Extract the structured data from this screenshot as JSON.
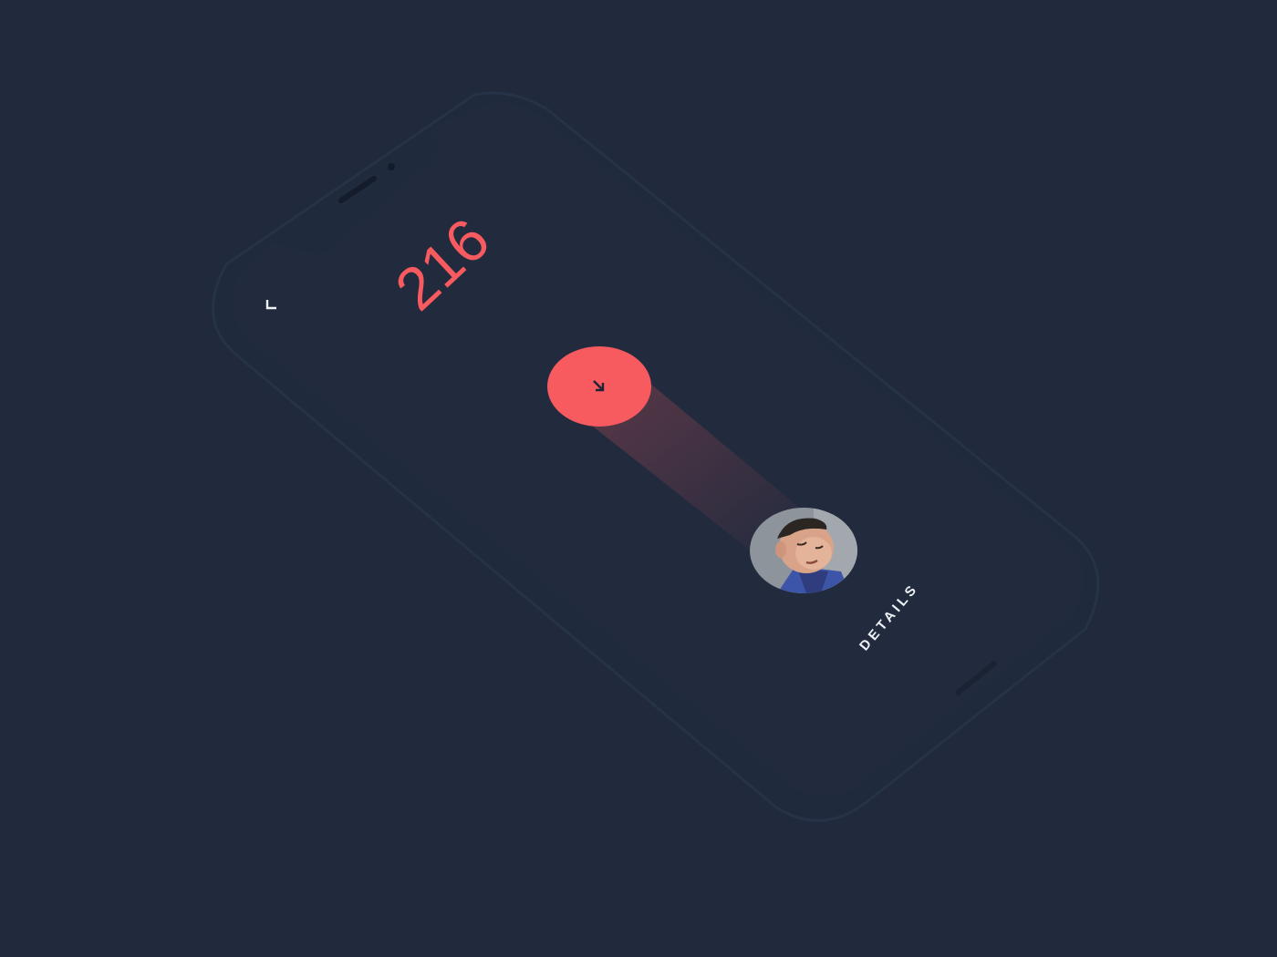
{
  "screen": {
    "counter_value": "216",
    "counter_suffix": "∞",
    "back_icon": "back-corner-icon",
    "action_icon": "arrow-down-right-icon",
    "details_label": "DETAILS"
  },
  "colors": {
    "background": "#212a3d",
    "phone_body": "#1f2a3e",
    "screen": "#222b3e",
    "accent": "#f75a5f",
    "text_light": "#eef1f6"
  }
}
